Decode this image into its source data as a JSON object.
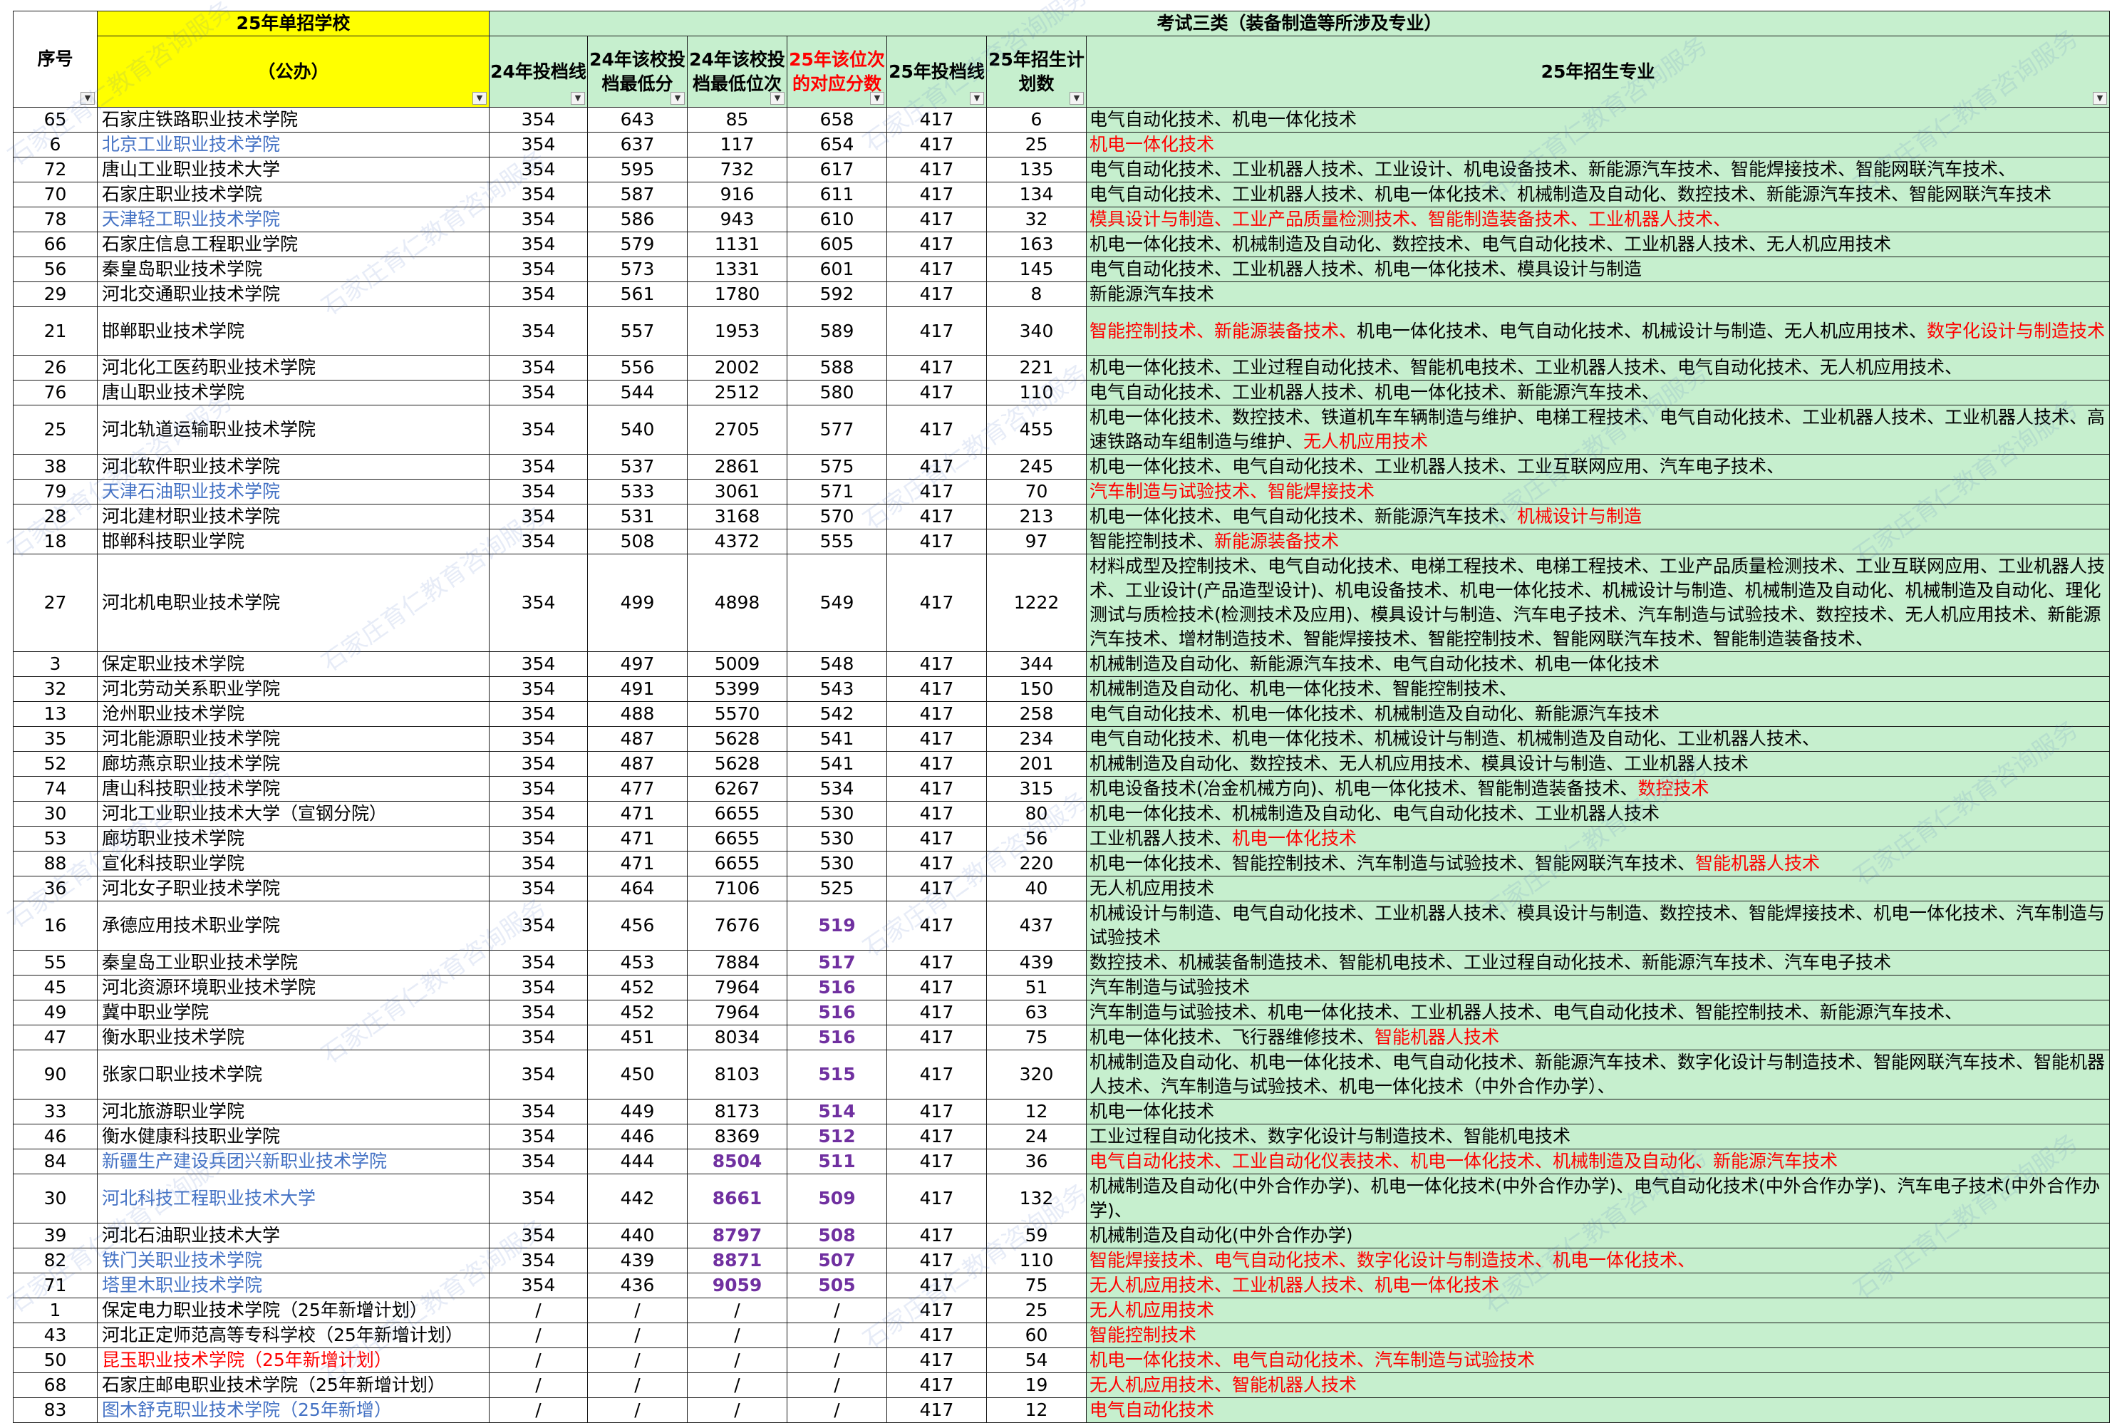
{
  "header": {
    "no": "序号",
    "school_group": "25年单招学校",
    "school_type": "（公办）",
    "exam_group": "考试三类（装备制造等所涉及专业）",
    "c24_line": "24年投档线",
    "c24_min": "24年该校投档最低分",
    "c24_rank": "24年该校投档最低位次",
    "c25_equiv": "25年该位次的对应分数",
    "c25_line": "25年投档线",
    "c25_plan": "25年招生计划数",
    "majors": "25年招生专业"
  },
  "watermark": "石家庄育仁教育咨询服务",
  "rows": [
    {
      "no": "65",
      "school": "石家庄铁路职业技术学院",
      "sc": "",
      "l24": "354",
      "min24": "643",
      "rank24": "85",
      "eq25": "658",
      "l25": "417",
      "plan": "6",
      "h": 1,
      "parts": [
        [
          "电气自动化技术、机电一体化技术",
          ""
        ]
      ]
    },
    {
      "no": "6",
      "school": "北京工业职业技术学院",
      "sc": "blue",
      "l24": "354",
      "min24": "637",
      "rank24": "117",
      "eq25": "654",
      "l25": "417",
      "plan": "25",
      "h": 1,
      "parts": [
        [
          "机电一体化技术",
          "red"
        ]
      ]
    },
    {
      "no": "72",
      "school": "唐山工业职业技术大学",
      "sc": "",
      "l24": "354",
      "min24": "595",
      "rank24": "732",
      "eq25": "617",
      "l25": "417",
      "plan": "135",
      "h": 1,
      "parts": [
        [
          "电气自动化技术、工业机器人技术、工业设计、机电设备技术、新能源汽车技术、智能焊接技术、智能网联汽车技术、",
          ""
        ]
      ]
    },
    {
      "no": "70",
      "school": "石家庄职业技术学院",
      "sc": "",
      "l24": "354",
      "min24": "587",
      "rank24": "916",
      "eq25": "611",
      "l25": "417",
      "plan": "134",
      "h": 1,
      "parts": [
        [
          "电气自动化技术、工业机器人技术、机电一体化技术、机械制造及自动化、数控技术、新能源汽车技术、智能网联汽车技术",
          ""
        ]
      ]
    },
    {
      "no": "78",
      "school": "天津轻工职业技术学院",
      "sc": "blue",
      "l24": "354",
      "min24": "586",
      "rank24": "943",
      "eq25": "610",
      "l25": "417",
      "plan": "32",
      "h": 1,
      "parts": [
        [
          "模具设计与制造、工业产品质量检测技术、智能制造装备技术、工业机器人技术、",
          "red"
        ]
      ]
    },
    {
      "no": "66",
      "school": "石家庄信息工程职业学院",
      "sc": "",
      "l24": "354",
      "min24": "579",
      "rank24": "1131",
      "eq25": "605",
      "l25": "417",
      "plan": "163",
      "h": 1,
      "parts": [
        [
          "机电一体化技术、机械制造及自动化、数控技术、电气自动化技术、工业机器人技术、无人机应用技术",
          ""
        ]
      ]
    },
    {
      "no": "56",
      "school": "秦皇岛职业技术学院",
      "sc": "",
      "l24": "354",
      "min24": "573",
      "rank24": "1331",
      "eq25": "601",
      "l25": "417",
      "plan": "145",
      "h": 1,
      "parts": [
        [
          "电气自动化技术、工业机器人技术、机电一体化技术、模具设计与制造",
          ""
        ]
      ]
    },
    {
      "no": "29",
      "school": "河北交通职业技术学院",
      "sc": "",
      "l24": "354",
      "min24": "561",
      "rank24": "1780",
      "eq25": "592",
      "l25": "417",
      "plan": "8",
      "h": 1,
      "parts": [
        [
          "新能源汽车技术",
          ""
        ]
      ]
    },
    {
      "no": "21",
      "school": "邯郸职业技术学院",
      "sc": "",
      "l24": "354",
      "min24": "557",
      "rank24": "1953",
      "eq25": "589",
      "l25": "417",
      "plan": "340",
      "h": 2,
      "parts": [
        [
          "智能控制技术、新能源装备技术、",
          "red"
        ],
        [
          "机电一体化技术、电气自动化技术、机械设计与制造、无人机应用技术、",
          ""
        ],
        [
          "数字化设计与制造技术",
          "red"
        ]
      ]
    },
    {
      "no": "26",
      "school": "河北化工医药职业技术学院",
      "sc": "",
      "l24": "354",
      "min24": "556",
      "rank24": "2002",
      "eq25": "588",
      "l25": "417",
      "plan": "221",
      "h": 1,
      "parts": [
        [
          "机电一体化技术、工业过程自动化技术、智能机电技术、工业机器人技术、电气自动化技术、无人机应用技术、",
          ""
        ]
      ]
    },
    {
      "no": "76",
      "school": "唐山职业技术学院",
      "sc": "",
      "l24": "354",
      "min24": "544",
      "rank24": "2512",
      "eq25": "580",
      "l25": "417",
      "plan": "110",
      "h": 1,
      "parts": [
        [
          "电气自动化技术、工业机器人技术、机电一体化技术、新能源汽车技术、",
          ""
        ]
      ]
    },
    {
      "no": "25",
      "school": "河北轨道运输职业技术学院",
      "sc": "",
      "l24": "354",
      "min24": "540",
      "rank24": "2705",
      "eq25": "577",
      "l25": "417",
      "plan": "455",
      "h": 2,
      "tri": true,
      "parts": [
        [
          "机电一体化技术、数控技术、铁道机车车辆制造与维护、电梯工程技术、电气自动化技术、工业机器人技术、工业机器人技术、高速铁路动车组制造与维护、",
          ""
        ],
        [
          "无人机应用技术",
          "red"
        ]
      ]
    },
    {
      "no": "38",
      "school": "河北软件职业技术学院",
      "sc": "",
      "l24": "354",
      "min24": "537",
      "rank24": "2861",
      "eq25": "575",
      "l25": "417",
      "plan": "245",
      "h": 1,
      "tri": true,
      "parts": [
        [
          "机电一体化技术、电气自动化技术、工业机器人技术、工业互联网应用、汽车电子技术、",
          ""
        ]
      ]
    },
    {
      "no": "79",
      "school": "天津石油职业技术学院",
      "sc": "blue",
      "l24": "354",
      "min24": "533",
      "rank24": "3061",
      "eq25": "571",
      "l25": "417",
      "plan": "70",
      "h": 1,
      "parts": [
        [
          "汽车制造与试验技术、智能焊接技术",
          "red"
        ]
      ]
    },
    {
      "no": "28",
      "school": "河北建材职业技术学院",
      "sc": "",
      "l24": "354",
      "min24": "531",
      "rank24": "3168",
      "eq25": "570",
      "l25": "417",
      "plan": "213",
      "h": 1,
      "parts": [
        [
          "机电一体化技术、电气自动化技术、新能源汽车技术、",
          ""
        ],
        [
          "机械设计与制造",
          "red"
        ]
      ]
    },
    {
      "no": "18",
      "school": "邯郸科技职业学院",
      "sc": "",
      "l24": "354",
      "min24": "508",
      "rank24": "4372",
      "eq25": "555",
      "l25": "417",
      "plan": "97",
      "h": 1,
      "parts": [
        [
          "智能控制技术、",
          ""
        ],
        [
          "新能源装备技术",
          "red"
        ]
      ]
    },
    {
      "no": "27",
      "school": "河北机电职业技术学院",
      "sc": "",
      "l24": "354",
      "min24": "499",
      "rank24": "4898",
      "eq25": "549",
      "l25": "417",
      "plan": "1222",
      "h": 4,
      "parts": [
        [
          "材料成型及控制技术、电气自动化技术、电梯工程技术、电梯工程技术、工业产品质量检测技术、工业互联网应用、工业机器人技术、工业设计(产品造型设计)、机电设备技术、机电一体化技术、机械设计与制造、机械制造及自动化、机械制造及自动化、理化测试与质检技术(检测技术及应用)、模具设计与制造、汽车电子技术、汽车制造与试验技术、数控技术、无人机应用技术、新能源汽车技术、增材制造技术、智能焊接技术、智能控制技术、智能网联汽车技术、智能制造装备技术、",
          ""
        ]
      ]
    },
    {
      "no": "3",
      "school": "保定职业技术学院",
      "sc": "",
      "l24": "354",
      "min24": "497",
      "rank24": "5009",
      "eq25": "548",
      "l25": "417",
      "plan": "344",
      "h": 1,
      "tri": true,
      "parts": [
        [
          "机械制造及自动化、新能源汽车技术、电气自动化技术、机电一体化技术",
          ""
        ]
      ]
    },
    {
      "no": "32",
      "school": "河北劳动关系职业学院",
      "sc": "",
      "l24": "354",
      "min24": "491",
      "rank24": "5399",
      "eq25": "543",
      "l25": "417",
      "plan": "150",
      "h": 1,
      "parts": [
        [
          "机械制造及自动化、机电一体化技术、智能控制技术、",
          ""
        ]
      ]
    },
    {
      "no": "13",
      "school": "沧州职业技术学院",
      "sc": "",
      "l24": "354",
      "min24": "488",
      "rank24": "5570",
      "eq25": "542",
      "l25": "417",
      "plan": "258",
      "h": 1,
      "parts": [
        [
          "电气自动化技术、机电一体化技术、机械制造及自动化、新能源汽车技术",
          ""
        ]
      ]
    },
    {
      "no": "35",
      "school": "河北能源职业技术学院",
      "sc": "",
      "l24": "354",
      "min24": "487",
      "rank24": "5628",
      "eq25": "541",
      "l25": "417",
      "plan": "234",
      "h": 1,
      "parts": [
        [
          "电气自动化技术、机电一体化技术、机械设计与制造、机械制造及自动化、工业机器人技术、",
          ""
        ]
      ]
    },
    {
      "no": "52",
      "school": "廊坊燕京职业技术学院",
      "sc": "",
      "l24": "354",
      "min24": "487",
      "rank24": "5628",
      "eq25": "541",
      "l25": "417",
      "plan": "201",
      "h": 1,
      "parts": [
        [
          "机械制造及自动化、数控技术、无人机应用技术、模具设计与制造、工业机器人技术",
          ""
        ]
      ]
    },
    {
      "no": "74",
      "school": "唐山科技职业技术学院",
      "sc": "",
      "l24": "354",
      "min24": "477",
      "rank24": "6267",
      "eq25": "534",
      "l25": "417",
      "plan": "315",
      "h": 1,
      "parts": [
        [
          "机电设备技术(冶金机械方向)、机电一体化技术、智能制造装备技术、",
          ""
        ],
        [
          "数控技术",
          "red"
        ]
      ]
    },
    {
      "no": "30",
      "school": "河北工业职业技术大学（宣钢分院）",
      "sc": "",
      "l24": "354",
      "min24": "471",
      "rank24": "6655",
      "eq25": "530",
      "l25": "417",
      "plan": "80",
      "h": 1,
      "parts": [
        [
          "机电一体化技术、机械制造及自动化、电气自动化技术、工业机器人技术",
          ""
        ]
      ]
    },
    {
      "no": "53",
      "school": "廊坊职业技术学院",
      "sc": "",
      "l24": "354",
      "min24": "471",
      "rank24": "6655",
      "eq25": "530",
      "l25": "417",
      "plan": "56",
      "h": 1,
      "parts": [
        [
          "工业机器人技术、",
          ""
        ],
        [
          "机电一体化技术",
          "red"
        ]
      ]
    },
    {
      "no": "88",
      "school": "宣化科技职业学院",
      "sc": "",
      "l24": "354",
      "min24": "471",
      "rank24": "6655",
      "eq25": "530",
      "l25": "417",
      "plan": "220",
      "h": 1,
      "parts": [
        [
          "机电一体化技术、智能控制技术、汽车制造与试验技术、智能网联汽车技术、",
          ""
        ],
        [
          "智能机器人技术",
          "red"
        ]
      ]
    },
    {
      "no": "36",
      "school": "河北女子职业技术学院",
      "sc": "",
      "l24": "354",
      "min24": "464",
      "rank24": "7106",
      "eq25": "525",
      "l25": "417",
      "plan": "40",
      "h": 1,
      "parts": [
        [
          "无人机应用技术",
          ""
        ]
      ]
    },
    {
      "no": "16",
      "school": "承德应用技术职业学院",
      "sc": "",
      "l24": "354",
      "min24": "456",
      "rank24": "7676",
      "eq25": "519",
      "eqc": "pur",
      "l25": "417",
      "plan": "437",
      "h": 2,
      "parts": [
        [
          "机械设计与制造、电气自动化技术、工业机器人技术、模具设计与制造、数控技术、智能焊接技术、机电一体化技术、汽车制造与试验技术",
          ""
        ]
      ]
    },
    {
      "no": "55",
      "school": "秦皇岛工业职业技术学院",
      "sc": "",
      "l24": "354",
      "min24": "453",
      "rank24": "7884",
      "eq25": "517",
      "eqc": "pur",
      "l25": "417",
      "plan": "439",
      "h": 1,
      "parts": [
        [
          "数控技术、机械装备制造技术、智能机电技术、工业过程自动化技术、新能源汽车技术、汽车电子技术",
          ""
        ]
      ]
    },
    {
      "no": "45",
      "school": "河北资源环境职业技术学院",
      "sc": "",
      "l24": "354",
      "min24": "452",
      "rank24": "7964",
      "eq25": "516",
      "eqc": "pur",
      "l25": "417",
      "plan": "51",
      "h": 1,
      "parts": [
        [
          "汽车制造与试验技术",
          ""
        ]
      ]
    },
    {
      "no": "49",
      "school": "冀中职业学院",
      "sc": "",
      "l24": "354",
      "min24": "452",
      "rank24": "7964",
      "eq25": "516",
      "eqc": "pur",
      "l25": "417",
      "plan": "63",
      "h": 1,
      "parts": [
        [
          "汽车制造与试验技术、机电一体化技术、工业机器人技术、电气自动化技术、智能控制技术、新能源汽车技术、",
          ""
        ]
      ]
    },
    {
      "no": "47",
      "school": "衡水职业技术学院",
      "sc": "",
      "l24": "354",
      "min24": "451",
      "rank24": "8034",
      "eq25": "516",
      "eqc": "pur",
      "l25": "417",
      "plan": "75",
      "h": 1,
      "parts": [
        [
          "机电一体化技术、飞行器维修技术、",
          ""
        ],
        [
          "智能机器人技术",
          "red"
        ]
      ]
    },
    {
      "no": "90",
      "school": "张家口职业技术学院",
      "sc": "",
      "l24": "354",
      "min24": "450",
      "rank24": "8103",
      "eq25": "515",
      "eqc": "pur",
      "l25": "417",
      "plan": "320",
      "h": 2,
      "tri": true,
      "parts": [
        [
          "机械制造及自动化、机电一体化技术、电气自动化技术、新能源汽车技术、数字化设计与制造技术、智能网联汽车技术、智能机器人技术、汽车制造与试验技术、机电一体化技术（中外合作办学）、",
          ""
        ]
      ]
    },
    {
      "no": "33",
      "school": "河北旅游职业学院",
      "sc": "",
      "l24": "354",
      "min24": "449",
      "rank24": "8173",
      "eq25": "514",
      "eqc": "pur",
      "l25": "417",
      "plan": "12",
      "h": 1,
      "parts": [
        [
          "机电一体化技术",
          ""
        ]
      ]
    },
    {
      "no": "46",
      "school": "衡水健康科技职业学院",
      "sc": "",
      "l24": "354",
      "min24": "446",
      "rank24": "8369",
      "eq25": "512",
      "eqc": "pur",
      "l25": "417",
      "plan": "24",
      "h": 1,
      "parts": [
        [
          "工业过程自动化技术、数字化设计与制造技术、智能机电技术",
          ""
        ]
      ]
    },
    {
      "no": "84",
      "school": "新疆生产建设兵团兴新职业技术学院",
      "sc": "blue",
      "l24": "354",
      "min24": "444",
      "rank24": "8504",
      "rc": "pur",
      "eq25": "511",
      "eqc": "pur",
      "l25": "417",
      "plan": "36",
      "h": 1,
      "parts": [
        [
          "电气自动化技术、工业自动化仪表技术、机电一体化技术、机械制造及自动化、新能源汽车技术",
          "red"
        ]
      ]
    },
    {
      "no": "30",
      "school": "河北科技工程职业技术大学",
      "sc": "blue",
      "l24": "354",
      "min24": "442",
      "rank24": "8661",
      "rc": "pur",
      "eq25": "509",
      "eqc": "pur",
      "l25": "417",
      "plan": "132",
      "h": 2,
      "parts": [
        [
          "机械制造及自动化(中外合作办学)、机电一体化技术(中外合作办学)、电气自动化技术(中外合作办学)、汽车电子技术(中外合作办学)、",
          ""
        ]
      ]
    },
    {
      "no": "39",
      "school": "河北石油职业技术大学",
      "sc": "",
      "l24": "354",
      "min24": "440",
      "rank24": "8797",
      "rc": "pur",
      "eq25": "508",
      "eqc": "pur",
      "l25": "417",
      "plan": "59",
      "h": 1,
      "parts": [
        [
          "机械制造及自动化(中外合作办学)",
          ""
        ]
      ]
    },
    {
      "no": "82",
      "school": "铁门关职业技术学院",
      "sc": "blue",
      "l24": "354",
      "min24": "439",
      "rank24": "8871",
      "rc": "pur",
      "eq25": "507",
      "eqc": "pur",
      "l25": "417",
      "plan": "110",
      "h": 1,
      "parts": [
        [
          "智能焊接技术、电气自动化技术、数字化设计与制造技术、机电一体化技术、",
          "red"
        ]
      ]
    },
    {
      "no": "71",
      "school": "塔里木职业技术学院",
      "sc": "blue",
      "l24": "354",
      "min24": "436",
      "rank24": "9059",
      "rc": "pur",
      "eq25": "505",
      "eqc": "pur",
      "l25": "417",
      "plan": "75",
      "h": 1,
      "parts": [
        [
          "无人机应用技术、工业机器人技术、机电一体化技术",
          "red"
        ]
      ]
    },
    {
      "no": "1",
      "school": "保定电力职业技术学院（25年新增计划）",
      "sc": "",
      "l24": "/",
      "min24": "/",
      "rank24": "/",
      "eq25": "/",
      "l25": "417",
      "plan": "25",
      "h": 1,
      "parts": [
        [
          "无人机应用技术",
          "red"
        ]
      ]
    },
    {
      "no": "43",
      "school": "河北正定师范高等专科学校（25年新增计划）",
      "sc": "",
      "l24": "/",
      "min24": "/",
      "rank24": "/",
      "eq25": "/",
      "l25": "417",
      "plan": "60",
      "h": 1,
      "parts": [
        [
          "智能控制技术",
          "red"
        ]
      ]
    },
    {
      "no": "50",
      "school": "昆玉职业技术学院（25年新增计划）",
      "sc": "red",
      "l24": "/",
      "min24": "/",
      "rank24": "/",
      "eq25": "/",
      "l25": "417",
      "plan": "54",
      "h": 1,
      "parts": [
        [
          "机电一体化技术、电气自动化技术、汽车制造与试验技术",
          "red"
        ]
      ]
    },
    {
      "no": "68",
      "school": "石家庄邮电职业技术学院（25年新增计划）",
      "sc": "",
      "l24": "/",
      "min24": "/",
      "rank24": "/",
      "eq25": "/",
      "l25": "417",
      "plan": "19",
      "h": 1,
      "parts": [
        [
          "无人机应用技术、智能机器人技术",
          "red"
        ]
      ]
    },
    {
      "no": "83",
      "school": "图木舒克职业技术学院（25年新增）",
      "sc": "blue",
      "l24": "/",
      "min24": "/",
      "rank24": "/",
      "eq25": "/",
      "l25": "417",
      "plan": "12",
      "h": 1,
      "parts": [
        [
          "电气自动化技术",
          "red"
        ]
      ]
    }
  ]
}
